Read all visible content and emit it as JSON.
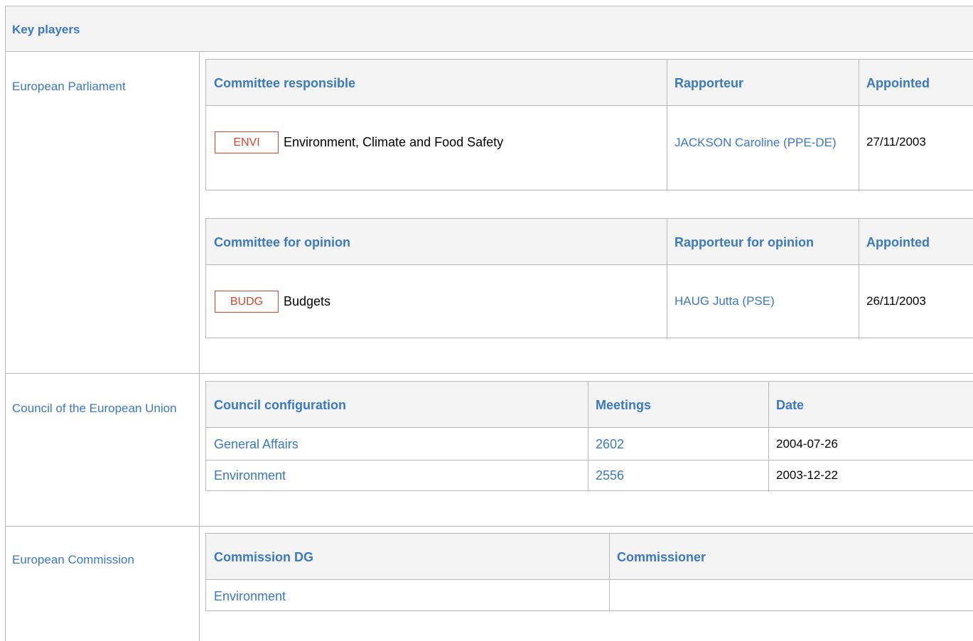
{
  "key_players": {
    "title": "Key players",
    "institutions": {
      "parliament": "European Parliament",
      "council": "Council of the European Union",
      "commission": "European Commission"
    }
  },
  "parliament": {
    "responsible": {
      "headers": [
        "Committee responsible",
        "Rapporteur",
        "Appointed"
      ],
      "row": {
        "badge": "ENVI",
        "committee": "Environment, Climate and Food Safety",
        "rapporteur": "JACKSON Caroline (PPE-DE)",
        "appointed": "27/11/2003"
      }
    },
    "opinion": {
      "headers": [
        "Committee for opinion",
        "Rapporteur for opinion",
        "Appointed"
      ],
      "row": {
        "badge": "BUDG",
        "committee": "Budgets",
        "rapporteur": "HAUG Jutta (PSE)",
        "appointed": "26/11/2003"
      }
    }
  },
  "council": {
    "headers": [
      "Council configuration",
      "Meetings",
      "Date"
    ],
    "rows": [
      {
        "configuration": "General Affairs",
        "meeting": "2602",
        "date": "2004-07-26"
      },
      {
        "configuration": "Environment",
        "meeting": "2556",
        "date": "2003-12-22"
      }
    ]
  },
  "commission": {
    "headers": [
      "Commission DG",
      "Commissioner"
    ],
    "rows": [
      {
        "dg": "Environment",
        "commissioner": ""
      }
    ]
  },
  "colors": {
    "link": "#3b78c2",
    "badge": "#d9442b",
    "header_bg": "#f4f4f4",
    "border": "#b9b9b9"
  }
}
